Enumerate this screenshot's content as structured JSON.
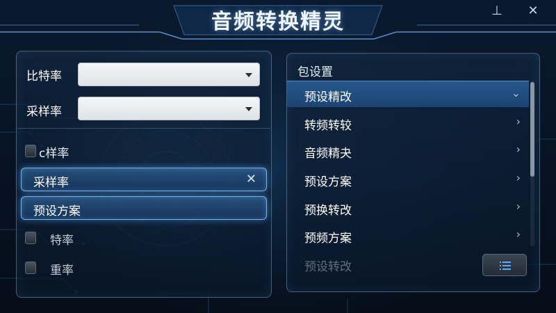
{
  "app": {
    "title": "音频转换精灵"
  },
  "window_controls": {
    "minimize_glyph": "⊥",
    "close_glyph": "✕"
  },
  "left_panel": {
    "bitrate_label": "比特率",
    "bitrate_value": "",
    "samplerate_label": "采样率",
    "samplerate_value": "",
    "checks": [
      {
        "label": "c样率",
        "checked": false
      },
      {
        "label": "特率",
        "checked": false
      },
      {
        "label": "重率",
        "checked": false
      }
    ],
    "pills": [
      {
        "label": "采样率",
        "close_glyph": "✕"
      },
      {
        "label": "预设方案"
      }
    ]
  },
  "right_panel": {
    "header": "包设置",
    "items": [
      {
        "label": "预设精改",
        "chevron": "⌄",
        "state": "active"
      },
      {
        "label": "转频转较",
        "chevron": "›"
      },
      {
        "label": "音频精夬",
        "chevron": "›"
      },
      {
        "label": "预设方案",
        "chevron": "›"
      },
      {
        "label": "预换转改",
        "chevron": "›"
      },
      {
        "label": "预频方案",
        "chevron": "›"
      },
      {
        "label": "预设转改",
        "state": "faded"
      }
    ],
    "list_button_icon": "list-icon"
  },
  "colors": {
    "accent": "#27578a",
    "glow": "#5aaaff",
    "background": "#06101d"
  }
}
